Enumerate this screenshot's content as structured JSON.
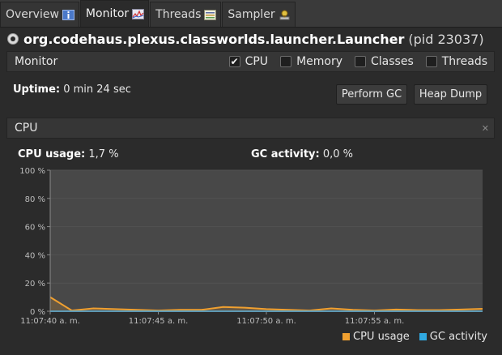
{
  "tabs": [
    {
      "label": "Overview",
      "icon": "info-icon",
      "active": false
    },
    {
      "label": "Monitor",
      "icon": "monitor-graph-icon",
      "active": true
    },
    {
      "label": "Threads",
      "icon": "threads-list-icon",
      "active": false
    },
    {
      "label": "Sampler",
      "icon": "sampler-icon",
      "active": false
    }
  ],
  "header": {
    "app_name": "org.codehaus.plexus.classworlds.launcher.Launcher",
    "pid": "(pid 23037)"
  },
  "monitor_bar": {
    "label": "Monitor",
    "checks": [
      {
        "label": "CPU",
        "checked": true
      },
      {
        "label": "Memory",
        "checked": false
      },
      {
        "label": "Classes",
        "checked": false
      },
      {
        "label": "Threads",
        "checked": false
      }
    ]
  },
  "uptime": {
    "label": "Uptime:",
    "value": "0 min 24 sec"
  },
  "buttons": {
    "perform_gc": "Perform GC",
    "heap_dump": "Heap Dump"
  },
  "cpu_panel": {
    "label": "CPU",
    "close_glyph": "✕"
  },
  "stats": {
    "cpu_usage_label": "CPU usage:",
    "cpu_usage_value": "1,7 %",
    "gc_activity_label": "GC activity:",
    "gc_activity_value": "0,0 %"
  },
  "colors": {
    "cpu": "#f0a030",
    "gc": "#30a8e0",
    "plot_bg": "#484848",
    "grid": "#525252"
  },
  "chart_data": {
    "type": "area",
    "ylim": [
      0,
      100
    ],
    "yticks": [
      "0 %",
      "20 %",
      "40 %",
      "60 %",
      "80 %",
      "100 %"
    ],
    "xticks": [
      "11:07:40 a. m.",
      "11:07:45 a. m.",
      "11:07:50 a. m.",
      "11:07:55 a. m."
    ],
    "xtick_seconds": [
      40,
      45,
      50,
      55
    ],
    "xlim_seconds": [
      40,
      60
    ],
    "series": [
      {
        "name": "CPU usage",
        "x": [
          40,
          41,
          42,
          43,
          44,
          45,
          46,
          47,
          48,
          49,
          50,
          51,
          52,
          53,
          54,
          55,
          56,
          57,
          58,
          59,
          60
        ],
        "y": [
          10,
          0.5,
          2,
          1.5,
          1,
          0.5,
          1,
          1,
          3,
          2.5,
          1.5,
          1,
          0.5,
          2,
          1,
          0.5,
          1.2,
          0.8,
          0.8,
          1.2,
          1.7
        ]
      },
      {
        "name": "GC activity",
        "x": [
          40,
          60
        ],
        "y": [
          0,
          0
        ]
      }
    ],
    "legend": [
      "CPU usage",
      "GC activity"
    ],
    "legend_position": "bottom-right",
    "grid": true
  }
}
